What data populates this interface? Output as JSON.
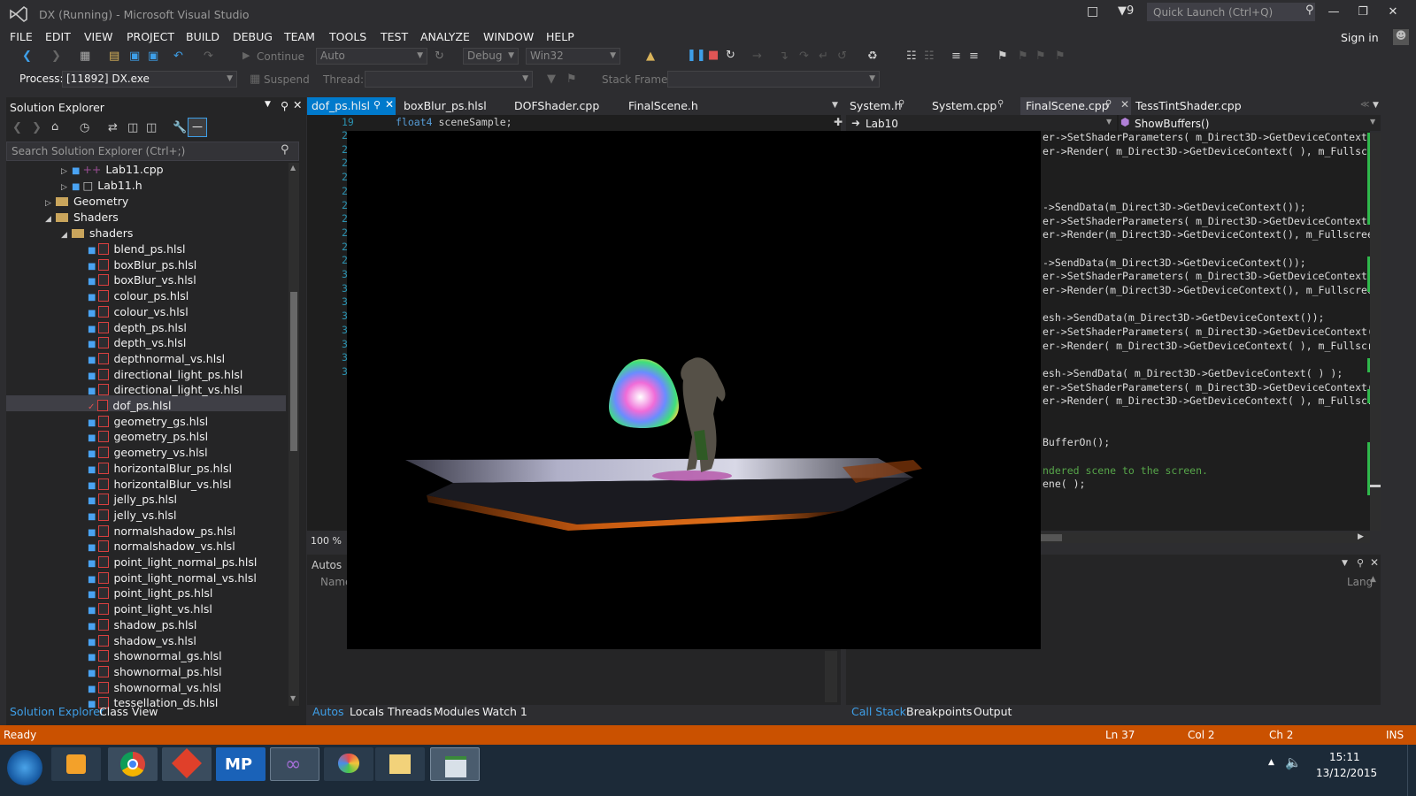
{
  "window": {
    "title": "DX (Running) - Microsoft Visual Studio",
    "notification_count": "9",
    "quick_launch_placeholder": "Quick Launch (Ctrl+Q)"
  },
  "menu": {
    "items": [
      "FILE",
      "EDIT",
      "VIEW",
      "PROJECT",
      "BUILD",
      "DEBUG",
      "TEAM",
      "TOOLS",
      "TEST",
      "ANALYZE",
      "WINDOW",
      "HELP"
    ],
    "sign_in": "Sign in"
  },
  "toolbar": {
    "continue_label": "Continue",
    "config_auto": "Auto",
    "config_debug": "Debug",
    "platform": "Win32",
    "process_label": "Process:",
    "process_value": "[11892] DX.exe",
    "suspend_label": "Suspend",
    "thread_label": "Thread:",
    "stack_frame_label": "Stack Frame:"
  },
  "solution_explorer": {
    "title": "Solution Explorer",
    "search_placeholder": "Search Solution Explorer (Ctrl+;)",
    "items": [
      {
        "label": "Lab11.cpp",
        "kind": "cpp"
      },
      {
        "label": "Lab11.h",
        "kind": "h"
      },
      {
        "label": "Geometry",
        "kind": "folder"
      },
      {
        "label": "Shaders",
        "kind": "folder"
      },
      {
        "label": "shaders",
        "kind": "folder"
      },
      {
        "label": "blend_ps.hlsl"
      },
      {
        "label": "boxBlur_ps.hlsl"
      },
      {
        "label": "boxBlur_vs.hlsl"
      },
      {
        "label": "colour_ps.hlsl"
      },
      {
        "label": "colour_vs.hlsl"
      },
      {
        "label": "depth_ps.hlsl"
      },
      {
        "label": "depth_vs.hlsl"
      },
      {
        "label": "depthnormal_vs.hlsl"
      },
      {
        "label": "directional_light_ps.hlsl"
      },
      {
        "label": "directional_light_vs.hlsl"
      },
      {
        "label": "dof_ps.hlsl"
      },
      {
        "label": "geometry_gs.hlsl"
      },
      {
        "label": "geometry_ps.hlsl"
      },
      {
        "label": "geometry_vs.hlsl"
      },
      {
        "label": "horizontalBlur_ps.hlsl"
      },
      {
        "label": "horizontalBlur_vs.hlsl"
      },
      {
        "label": "jelly_ps.hlsl"
      },
      {
        "label": "jelly_vs.hlsl"
      },
      {
        "label": "normalshadow_ps.hlsl"
      },
      {
        "label": "normalshadow_vs.hlsl"
      },
      {
        "label": "point_light_normal_ps.hlsl"
      },
      {
        "label": "point_light_normal_vs.hlsl"
      },
      {
        "label": "point_light_ps.hlsl"
      },
      {
        "label": "point_light_vs.hlsl"
      },
      {
        "label": "shadow_ps.hlsl"
      },
      {
        "label": "shadow_vs.hlsl"
      },
      {
        "label": "shownormal_gs.hlsl"
      },
      {
        "label": "shownormal_ps.hlsl"
      },
      {
        "label": "shownormal_vs.hlsl"
      },
      {
        "label": "tessellation_ds.hlsl"
      }
    ],
    "bottom_tabs": [
      "Solution Explorer",
      "Class View"
    ]
  },
  "editor_left": {
    "tabs": [
      "dof_ps.hlsl",
      "boxBlur_ps.hlsl",
      "DOFShader.cpp",
      "FinalScene.h"
    ],
    "line_number": "19",
    "code_keyword": "float4",
    "code_rest": " sceneSample;",
    "gutter_digits": [
      "2",
      "2",
      "2",
      "2",
      "2",
      "2",
      "2",
      "2",
      "2",
      "2",
      "3",
      "3",
      "3",
      "3",
      "3",
      "3",
      "3",
      "3"
    ],
    "zoom": "100 %"
  },
  "editor_right": {
    "tabs": [
      "System.h",
      "System.cpp",
      "FinalScene.cpp",
      "TessTintShader.cpp"
    ],
    "scope": "Lab10",
    "member": "ShowBuffers()",
    "code_lines": [
      "er->SetShaderParameters( m_Direct3D->GetDeviceContext(",
      "er->Render( m_Direct3D->GetDeviceContext( ), m_Fullscre",
      "->SendData(m_Direct3D->GetDeviceContext());",
      "er->SetShaderParameters( m_Direct3D->GetDeviceContext(",
      "er->Render(m_Direct3D->GetDeviceContext(), m_Fullscreen",
      "->SendData(m_Direct3D->GetDeviceContext());",
      "er->SetShaderParameters( m_Direct3D->GetDeviceContext(",
      "er->Render(m_Direct3D->GetDeviceContext(), m_Fullscreen",
      "esh->SendData(m_Direct3D->GetDeviceContext());",
      "er->SetShaderParameters( m_Direct3D->GetDeviceContext(",
      "er->Render( m_Direct3D->GetDeviceContext( ), m_Fullscre",
      "esh->SendData( m_Direct3D->GetDeviceContext( ) );",
      "er->SetShaderParameters( m_Direct3D->GetDeviceContext(",
      "er->Render( m_Direct3D->GetDeviceContext( ), m_Fullscre",
      "BufferOn();",
      "ndered scene to the screen.",
      "ene( );"
    ]
  },
  "panels": {
    "autos_title": "Autos",
    "autos_column": "Name",
    "callstack_column": "Lang",
    "left_tabs": [
      "Autos",
      "Locals",
      "Threads",
      "Modules",
      "Watch 1"
    ],
    "right_tabs": [
      "Call Stack",
      "Breakpoints",
      "Output"
    ]
  },
  "status": {
    "text": "Ready",
    "ln": "Ln 37",
    "col": "Col 2",
    "ch": "Ch 2",
    "mode": "INS"
  },
  "taskbar": {
    "time": "15:11",
    "date": "13/12/2015",
    "mp_label": "MP"
  },
  "colors": {
    "accent": "#007acc",
    "status_bar": "#ca5100",
    "selection": "#3f3f46"
  }
}
